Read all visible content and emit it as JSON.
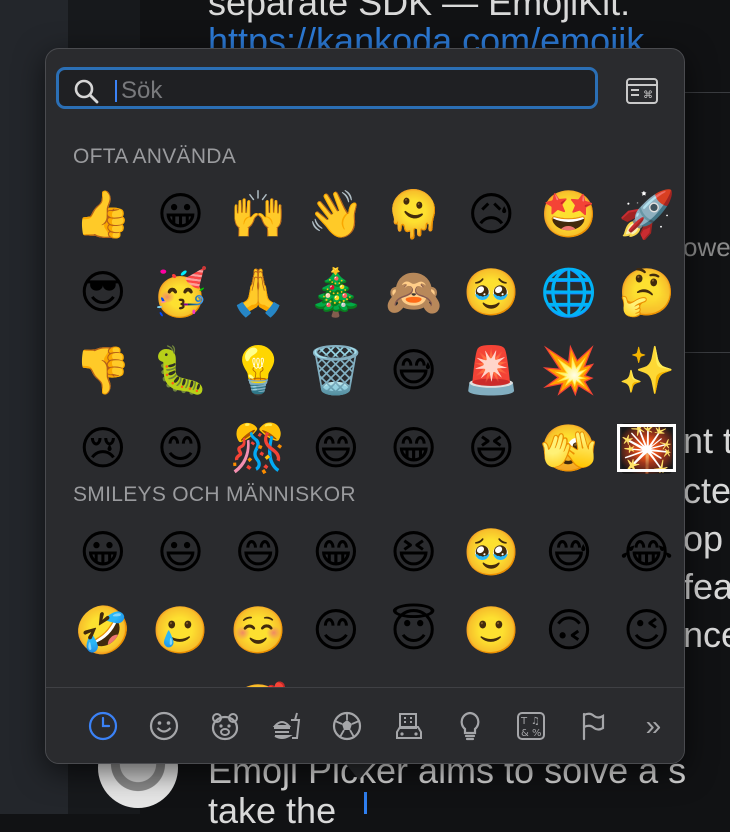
{
  "background": {
    "line1": "separate SDK — EmojiKit:",
    "link": "https://kankoda.com/emojik",
    "right_frag_1": "owe",
    "right_frag_2": "nt t",
    "right_frag_3": "cted",
    "right_frag_4": "op",
    "right_frag_5": "feat",
    "right_frag_6": "nce",
    "bottom_line": "Emoji Picker aims to solve a s",
    "bottom_line_2": "take the"
  },
  "search": {
    "placeholder": "Sök",
    "value": ""
  },
  "sections": {
    "frequently_used": {
      "title": "OFTA ANVÄNDA",
      "emojis": [
        "👍",
        "😀",
        "🙌",
        "👋",
        "🫠",
        "😥",
        "🤩",
        "🚀",
        "😎",
        "🥳",
        "🙏",
        "🎄",
        "🙈",
        "🥹",
        "🌐",
        "🤔",
        "👎",
        "🐛",
        "💡",
        "🗑️",
        "😅",
        "🚨",
        "💥",
        "✨",
        "😢",
        "😊",
        "🎊",
        "😄",
        "😁",
        "😆",
        "🫣",
        "🎇"
      ]
    },
    "smileys": {
      "title": "SMILEYS OCH MÄNNISKOR",
      "emojis": [
        "😀",
        "😃",
        "😄",
        "😁",
        "😆",
        "🥹",
        "😅",
        "😂",
        "🤣",
        "🥲",
        "☺️",
        "😊",
        "😇",
        "🙂",
        "🙃",
        "😉",
        "😌",
        "😍",
        "🥰",
        "😘",
        "😗",
        "😙",
        "😚",
        "😋"
      ]
    }
  },
  "tabs": [
    {
      "name": "recent",
      "icon": "clock-icon",
      "active": true
    },
    {
      "name": "smileys",
      "icon": "smiley-icon"
    },
    {
      "name": "animals",
      "icon": "bear-icon"
    },
    {
      "name": "food",
      "icon": "burger-icon"
    },
    {
      "name": "activity",
      "icon": "soccer-ball-icon"
    },
    {
      "name": "travel",
      "icon": "building-car-icon"
    },
    {
      "name": "objects",
      "icon": "lightbulb-icon"
    },
    {
      "name": "symbols",
      "icon": "symbols-icon"
    },
    {
      "name": "flags",
      "icon": "flag-icon"
    }
  ],
  "more_label": "»",
  "colors": {
    "accent": "#3b82f6",
    "search_border": "#2b6fb5",
    "panel": "#2a2b2e"
  }
}
